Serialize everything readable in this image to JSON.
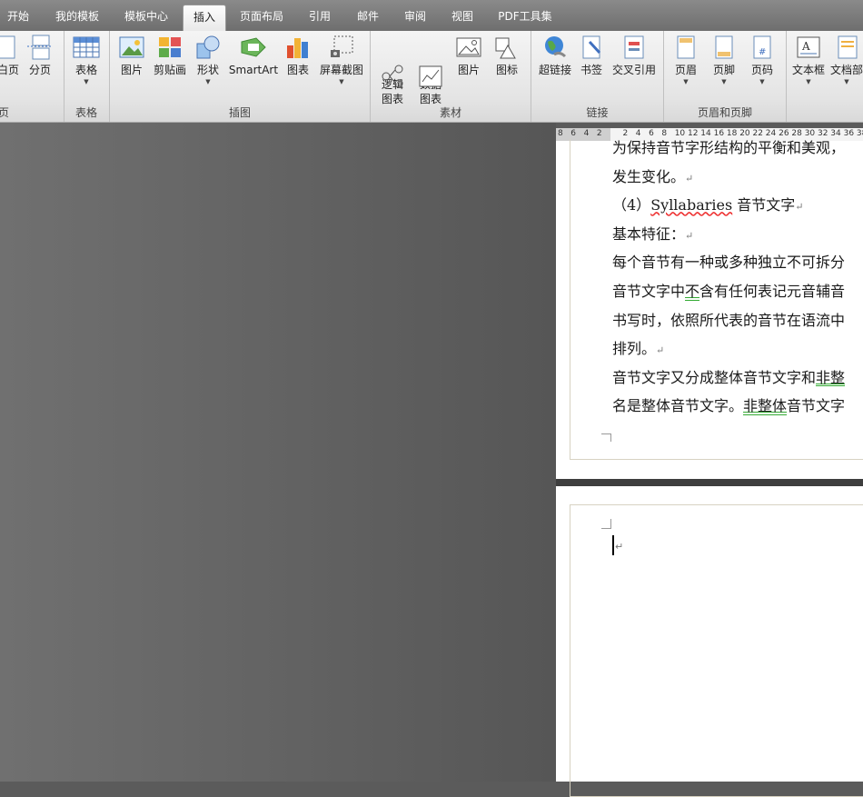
{
  "tabs": [
    {
      "label": "开始"
    },
    {
      "label": "我的模板"
    },
    {
      "label": "模板中心"
    },
    {
      "label": "插入",
      "active": true
    },
    {
      "label": "页面布局"
    },
    {
      "label": "引用"
    },
    {
      "label": "邮件"
    },
    {
      "label": "审阅"
    },
    {
      "label": "视图"
    },
    {
      "label": "PDF工具集"
    }
  ],
  "ribbon": {
    "groups": {
      "pages": {
        "label": "页",
        "buttons": [
          {
            "label": "白页"
          },
          {
            "label": "分页"
          }
        ]
      },
      "table": {
        "label": "表格",
        "buttons": [
          {
            "label": "表格"
          }
        ]
      },
      "illustrations": {
        "label": "插图",
        "buttons": [
          {
            "label": "图片"
          },
          {
            "label": "剪贴画"
          },
          {
            "label": "形状"
          },
          {
            "label": "SmartArt"
          },
          {
            "label": "图表"
          },
          {
            "label": "屏幕截图"
          }
        ]
      },
      "material": {
        "label": "素材",
        "buttons": [
          {
            "label": "逻辑\n图表"
          },
          {
            "label": "数据\n图表"
          },
          {
            "label": "图片"
          },
          {
            "label": "图标"
          }
        ]
      },
      "links": {
        "label": "链接",
        "buttons": [
          {
            "label": "超链接"
          },
          {
            "label": "书签"
          },
          {
            "label": "交叉引用"
          }
        ]
      },
      "header_footer": {
        "label": "页眉和页脚",
        "buttons": [
          {
            "label": "页眉"
          },
          {
            "label": "页脚"
          },
          {
            "label": "页码"
          }
        ]
      },
      "text": {
        "label": "",
        "buttons": [
          {
            "label": "文本框"
          },
          {
            "label": "文档部"
          }
        ]
      }
    }
  },
  "ruler": {
    "ticks": [
      "8",
      "6",
      "4",
      "2",
      "",
      "2",
      "4",
      "6",
      "8",
      "10",
      "12",
      "14",
      "16",
      "18",
      "20",
      "22",
      "24",
      "26",
      "28",
      "30",
      "32",
      "34",
      "36",
      "38"
    ]
  },
  "document": {
    "page1_lines": [
      {
        "parts": [
          {
            "t": "为保持音节字形结构的平衡和美观，"
          }
        ]
      },
      {
        "parts": [
          {
            "t": "发生变化。"
          },
          {
            "t": "↵",
            "mark": true
          }
        ]
      },
      {
        "parts": [
          {
            "t": "（4）"
          },
          {
            "t": "Syllabaries",
            "sq": true
          },
          {
            "t": " 音节文字"
          },
          {
            "t": "↵",
            "mark": true
          }
        ]
      },
      {
        "parts": [
          {
            "t": "基本特征："
          },
          {
            "t": "↵",
            "mark": true
          }
        ]
      },
      {
        "parts": [
          {
            "t": "每个音节有一种或多种独立不可拆分"
          }
        ]
      },
      {
        "parts": [
          {
            "t": "音节文字中"
          },
          {
            "t": "不",
            "gq": true
          },
          {
            "t": "含有任何表记元音辅音"
          }
        ]
      },
      {
        "parts": [
          {
            "t": "书写时，依照所代表的音节在语流中"
          }
        ]
      },
      {
        "parts": [
          {
            "t": "排列。"
          },
          {
            "t": "↵",
            "mark": true
          }
        ]
      },
      {
        "parts": [
          {
            "t": "音节文字又分成整体音节文字和"
          },
          {
            "t": "非整",
            "gq": true
          }
        ]
      },
      {
        "parts": [
          {
            "t": "名是整体音节文字。"
          },
          {
            "t": "非整体",
            "gq": true
          },
          {
            "t": "音节文字"
          }
        ]
      }
    ],
    "page2_cursor_mark": "↵"
  }
}
